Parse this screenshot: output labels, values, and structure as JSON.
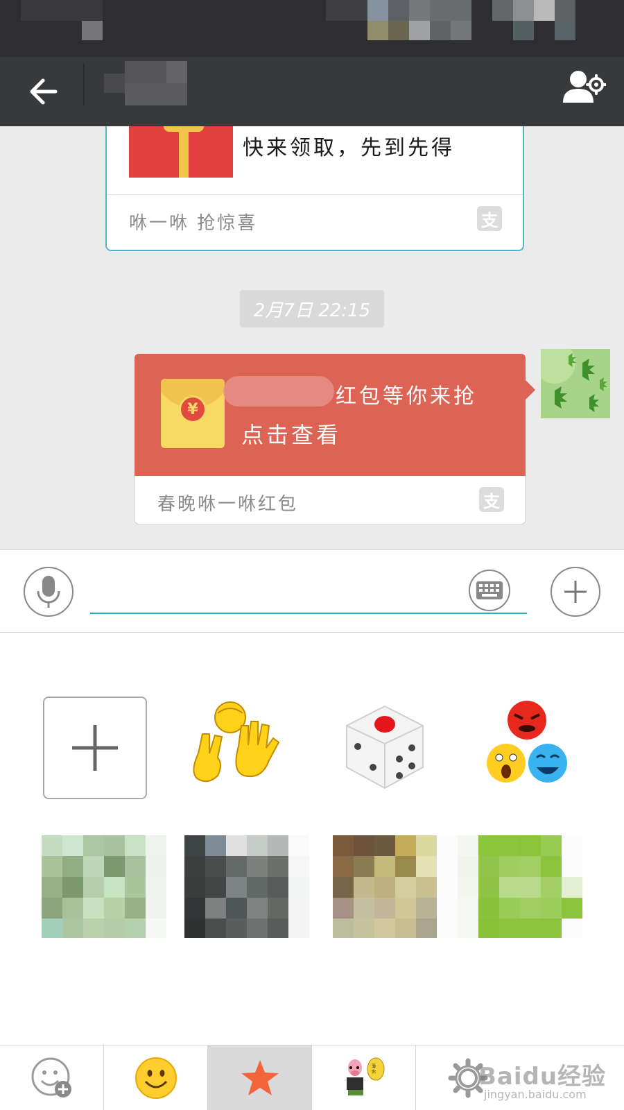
{
  "title_bar": {
    "back_icon": "arrow-left-icon",
    "profile_icon": "user-settings-icon"
  },
  "messages": {
    "top_card": {
      "text": "快来领取，先到先得",
      "footer": "咻一咻 抢惊喜",
      "icon": "alipay-icon",
      "footer_icon_glyph": "支"
    },
    "timestamp": "2月7日 22:15",
    "red_packet": {
      "line1": "红包等你来抢",
      "line2": "点击查看",
      "currency_glyph": "¥",
      "footer": "春晚咻一咻红包",
      "footer_icon_glyph": "支",
      "color": "#dd6355"
    }
  },
  "input_bar": {
    "placeholder": "",
    "mic_icon": "microphone-icon",
    "keyboard_icon": "keyboard-icon",
    "more_icon": "plus-circle-icon",
    "accent_color": "#27aac4"
  },
  "sticker_panel": {
    "row1": [
      "add-sticker",
      "rock-paper-scissors-sticker",
      "dice-sticker",
      "emoji-faces-sticker"
    ],
    "row2": [
      "blurred-sticker",
      "blurred-sticker",
      "blurred-sticker",
      "blurred-sticker"
    ]
  },
  "tabs": [
    {
      "icon": "emoji-add-icon",
      "active": false
    },
    {
      "icon": "smiley-icon",
      "active": false
    },
    {
      "icon": "star-icon",
      "active": true
    },
    {
      "icon": "pig-sticker-icon",
      "active": false
    },
    {
      "icon": "gear-icon",
      "active": false
    }
  ],
  "watermark": {
    "brand": "Baidu经验",
    "url": "jingyan.baidu.com"
  }
}
